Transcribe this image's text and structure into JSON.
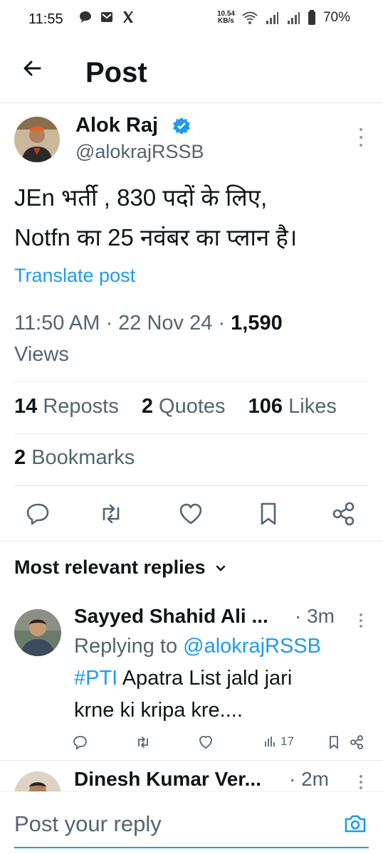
{
  "status_bar": {
    "time": "11:55",
    "net_speed_top": "10.54",
    "net_speed_bottom": "KB/s",
    "battery": "70%",
    "icons": [
      "chat-icon",
      "mail-icon",
      "x-icon",
      "wifi-icon",
      "signal-icon",
      "signal-icon",
      "battery-icon"
    ]
  },
  "header": {
    "title": "Post"
  },
  "post": {
    "author_name": "Alok Raj",
    "author_handle": "@alokrajRSSB",
    "text_line1": "JEn भर्ती , 830 पदों के लिए,",
    "text_line2": "Notfn का 25 नवंबर का प्लान है।",
    "translate": "Translate post",
    "time": "11:50 AM",
    "date": "22 Nov 24",
    "views_count": "1,590",
    "views_label": "Views",
    "reposts_count": "14",
    "reposts_label": "Reposts",
    "quotes_count": "2",
    "quotes_label": "Quotes",
    "likes_count": "106",
    "likes_label": "Likes",
    "bookmarks_count": "2",
    "bookmarks_label": "Bookmarks"
  },
  "replies": {
    "heading": "Most relevant replies",
    "items": [
      {
        "name": "Sayyed Shahid Ali ...",
        "time": "· 3m",
        "replying_prefix": "Replying to",
        "replying_handle": "@alokrajRSSB",
        "hashtag": "#PTI",
        "text_rest": "Apatra List jald jari",
        "text_line2": "krne ki kripa kre....",
        "views": "17"
      },
      {
        "name": "Dinesh Kumar Ver...",
        "time": "· 2m"
      }
    ]
  },
  "compose": {
    "placeholder": "Post your reply"
  },
  "colors": {
    "accent": "#1d9bf0",
    "text": "#0f1419",
    "muted": "#536471"
  }
}
